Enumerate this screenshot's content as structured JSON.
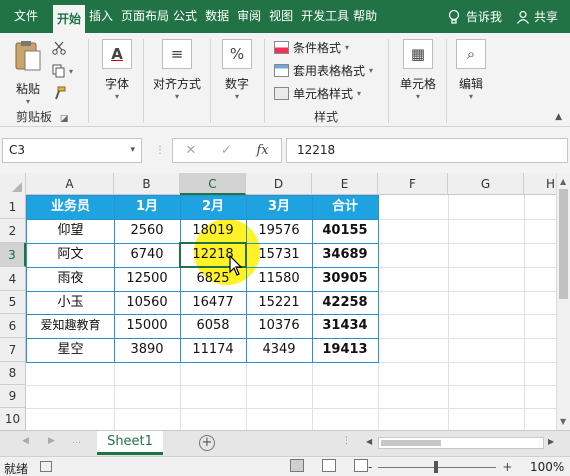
{
  "ribbon_tabs": [
    {
      "label": "文件",
      "active": false
    },
    {
      "label": "开始",
      "active": true
    },
    {
      "label": "插入",
      "active": false
    },
    {
      "label": "页面布局",
      "active": false
    },
    {
      "label": "公式",
      "active": false
    },
    {
      "label": "数据",
      "active": false
    },
    {
      "label": "审阅",
      "active": false
    },
    {
      "label": "视图",
      "active": false
    },
    {
      "label": "开发工具",
      "active": false
    },
    {
      "label": "帮助",
      "active": false
    }
  ],
  "tell_me": "告诉我",
  "share": "共享",
  "clipboard": {
    "paste": "粘贴",
    "group_label": "剪贴板"
  },
  "font_btn": "字体",
  "align_btn": "对齐方式",
  "number_btn": "数字",
  "styles": {
    "conditional": "条件格式",
    "table_format": "套用表格格式",
    "cell_styles": "单元格样式",
    "group_label": "样式"
  },
  "cells_btn": "单元格",
  "edit_btn": "编辑",
  "name_box": "C3",
  "formula_value": "12218",
  "columns": [
    "A",
    "B",
    "C",
    "D",
    "E",
    "F",
    "G",
    "H"
  ],
  "rows": [
    "1",
    "2",
    "3",
    "4",
    "5",
    "6",
    "7",
    "8",
    "9",
    "10"
  ],
  "table": {
    "headers": [
      "业务员",
      "1月",
      "2月",
      "3月",
      "合计"
    ],
    "data": [
      [
        "仰望",
        "2560",
        "18019",
        "19576",
        "40155"
      ],
      [
        "阿文",
        "6740",
        "12218",
        "15731",
        "34689"
      ],
      [
        "雨夜",
        "12500",
        "6825",
        "11580",
        "30905"
      ],
      [
        "小玉",
        "10560",
        "16477",
        "15221",
        "42258"
      ],
      [
        "爱知趣教育",
        "15000",
        "6058",
        "10376",
        "31434"
      ],
      [
        "星空",
        "3890",
        "11174",
        "4349",
        "19413"
      ]
    ]
  },
  "colors": {
    "ribbon": "#217346",
    "table_header": "#1fa3e0",
    "highlight": "#fff000"
  },
  "sheet_tab": "Sheet1",
  "status": {
    "ready": "就绪",
    "zoom": "100%",
    "zoom_minus": "-",
    "zoom_plus": "+"
  }
}
